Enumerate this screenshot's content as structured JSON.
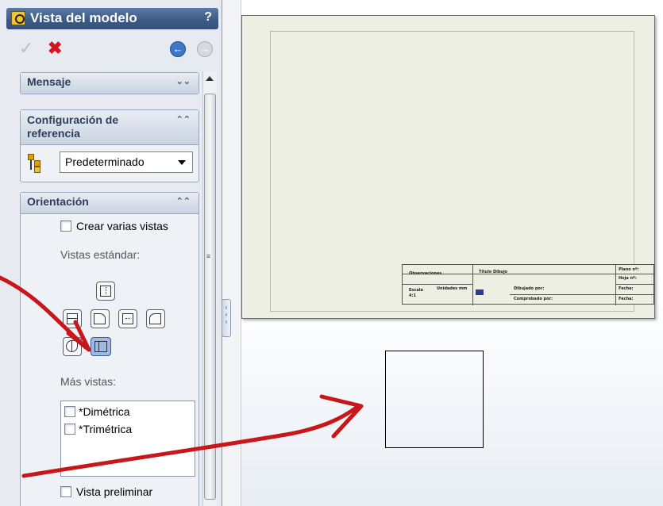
{
  "panel": {
    "title": "Vista del modelo",
    "help": "?",
    "accent": "#3d5b86"
  },
  "toolbar": {
    "ok_glyph": "✓",
    "cancel_glyph": "✖",
    "back_glyph": "←",
    "forward_glyph": "→"
  },
  "groups": {
    "message": {
      "title": "Mensaje"
    },
    "reference_config": {
      "title": "Configuración de referencia",
      "selected_value": "Predeterminado"
    },
    "orientation": {
      "title": "Orientación",
      "create_multiple_label": "Crear varias vistas",
      "create_multiple_checked": false,
      "standard_views_label": "Vistas estándar:",
      "standard_view_buttons": [
        "top-view-icon",
        "front-view-icon",
        "left-view-icon",
        "back-view-icon",
        "right-view-icon",
        "isometric-view-icon",
        "bottom-view-icon"
      ],
      "selected_view": "bottom-view-icon",
      "more_views_label": "Más vistas:",
      "more_views": [
        {
          "label": "*Dimétrica",
          "checked": false
        },
        {
          "label": "*Trimétrica",
          "checked": false
        }
      ],
      "preview_label": "Vista preliminar",
      "preview_checked": false
    }
  },
  "titleblock": {
    "observaciones": "Observaciones",
    "titulo": "Título Dibujo",
    "plano": "Plano nº:",
    "hoja": "Hoja nº:",
    "escala_label": "Escala",
    "escala_value": "4:1",
    "unidades_label": "Unidades mm",
    "dibujado": "Dibujado por:",
    "comprobado": "Comprobado por:",
    "fecha1": "Fecha:",
    "fecha2": "Fecha:"
  },
  "annotation_color": "#c8171a"
}
